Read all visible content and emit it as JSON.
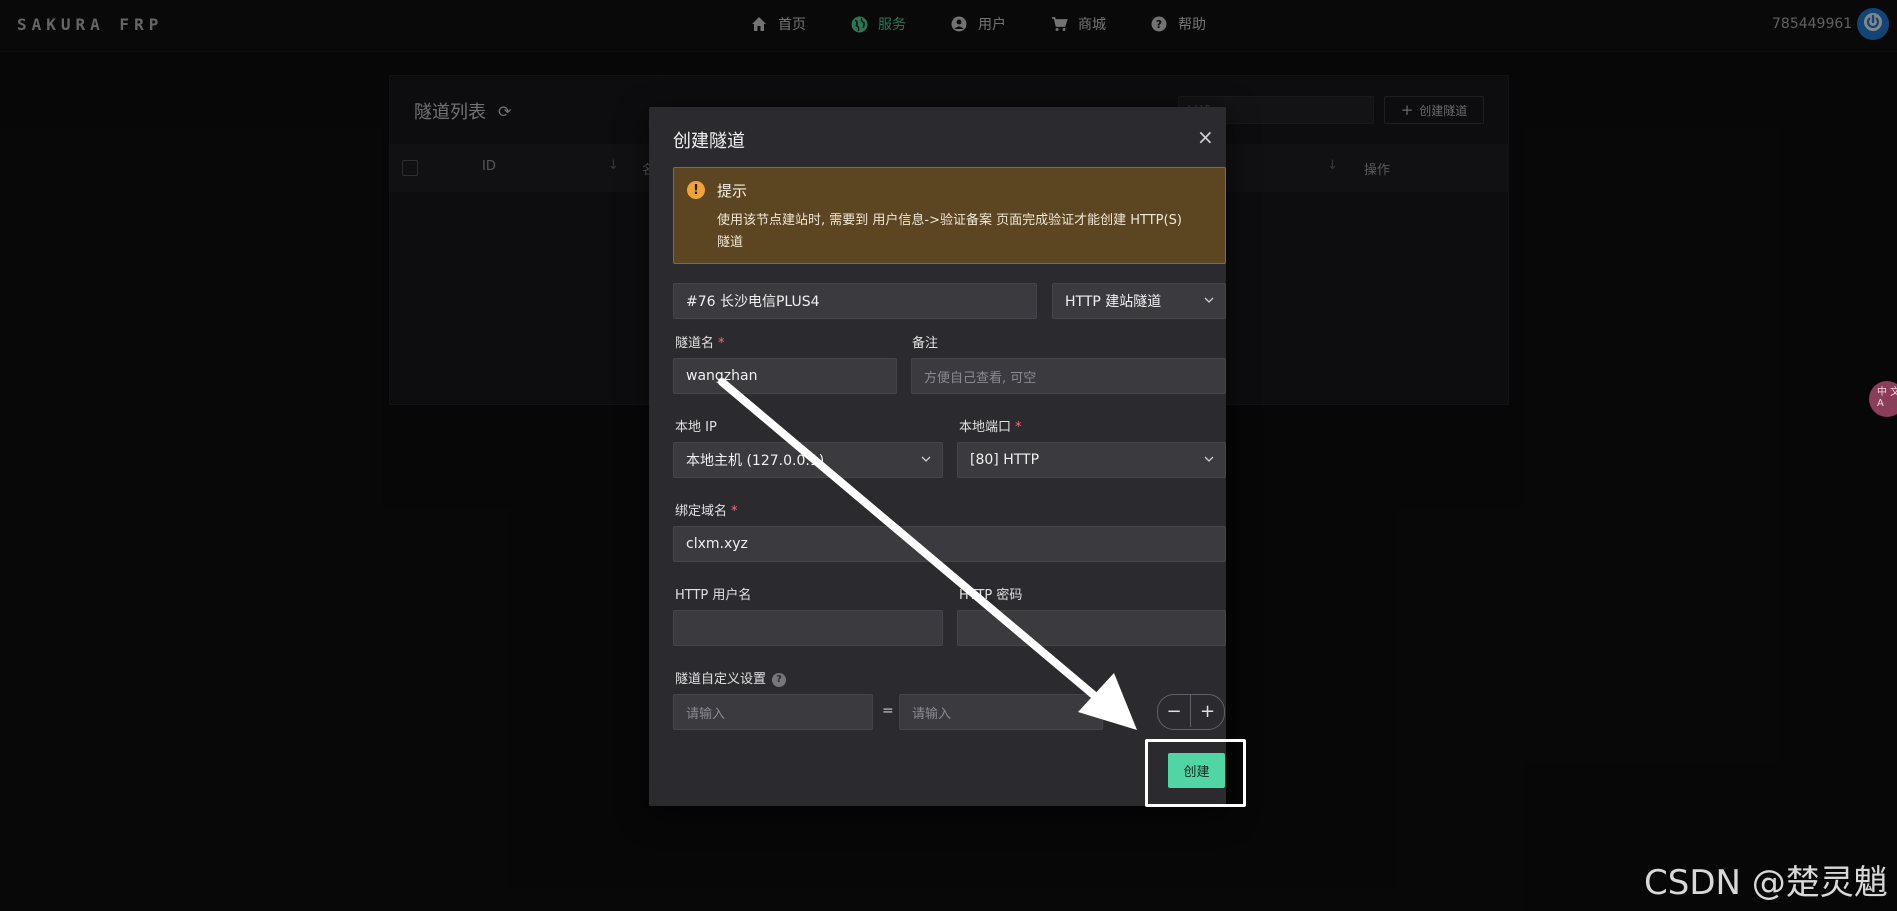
{
  "app": {
    "logo": "SAKURA FRP",
    "user_id": "785449961"
  },
  "nav": [
    {
      "label": "首页",
      "icon": "home-icon"
    },
    {
      "label": "服务",
      "icon": "globe-icon",
      "active": true
    },
    {
      "label": "用户",
      "icon": "user-icon"
    },
    {
      "label": "商城",
      "icon": "cart-icon"
    },
    {
      "label": "帮助",
      "icon": "help-icon"
    }
  ],
  "tunnel_list": {
    "title": "隧道列表",
    "filter_placeholder": "过滤",
    "create_button": "创建隧道",
    "columns": {
      "id": "ID",
      "col2": "名",
      "op": "操作"
    }
  },
  "modal": {
    "title": "创建隧道",
    "alert": {
      "title": "提示",
      "body": "使用该节点建站时, 需要到 用户信息->验证备案 页面完成验证才能创建 HTTP(S) 隧道"
    },
    "node_value": "#76 长沙电信PLUS4",
    "type_value": "HTTP 建站隧道",
    "tunnel_name_label": "隧道名",
    "tunnel_name_value": "wangzhan",
    "note_label": "备注",
    "note_placeholder": "方便自己查看, 可空",
    "local_ip_label": "本地 IP",
    "local_ip_value": "本地主机 (127.0.0.1)",
    "local_port_label": "本地端口",
    "local_port_value": "[80] HTTP",
    "domain_label": "绑定域名",
    "domain_value": "clxm.xyz",
    "http_user_label": "HTTP 用户名",
    "http_user_value": "",
    "http_pass_label": "HTTP 密码",
    "http_pass_value": "",
    "custom_label": "隧道自定义设置",
    "custom_key_placeholder": "请输入",
    "custom_eq": "=",
    "custom_value_placeholder": "请输入",
    "minus": "−",
    "plus": "+",
    "required_mark": "*",
    "create_button": "创建",
    "close": "×"
  },
  "side_bubble": "中\n文A",
  "watermark": "CSDN @楚灵魈",
  "colors": {
    "accent": "#4fd69c",
    "alert_bg": "#5c4521",
    "primary_button": "#4fd6a4"
  }
}
